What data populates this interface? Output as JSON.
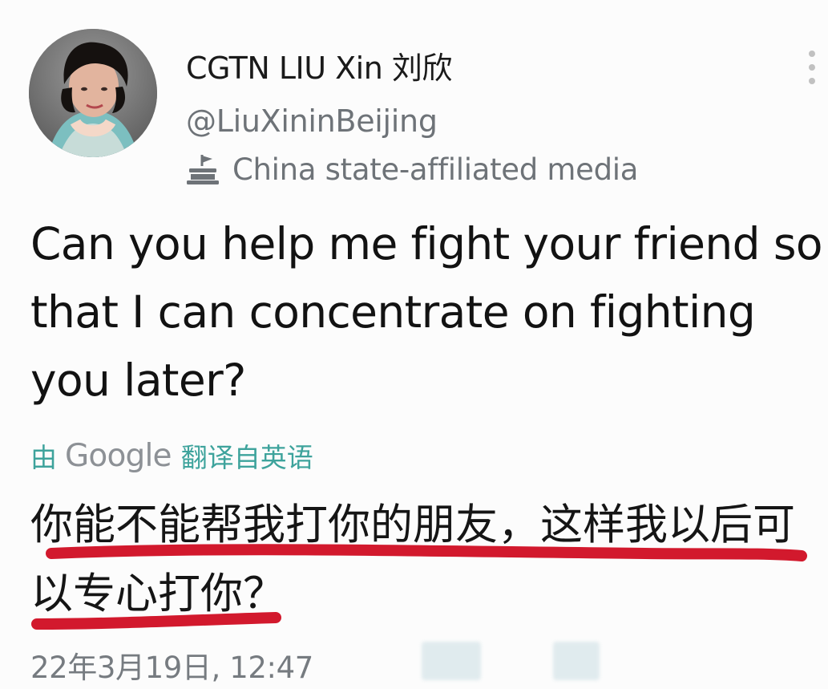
{
  "tweet": {
    "author": {
      "display_name": "CGTN LIU Xin 刘欣",
      "handle": "@LiuXininBeijing",
      "label": "China state-affiliated media",
      "label_icon": "building-flag-icon",
      "avatar_icon": "profile-photo"
    },
    "text": "Can you help me fight your friend so that I can concentrate on fighting you later?",
    "translation": {
      "prefix": "由",
      "provider": "Google",
      "suffix": "翻译自英语",
      "text": "你能不能帮我打你的朋友，这样我以后可以专心打你？"
    },
    "timestamp": "22年3月19日, 12:47",
    "more_icon": "more-vertical-icon"
  },
  "colors": {
    "text": "#141414",
    "secondary_text": "#6e7378",
    "translation_accent": "#3ea39c",
    "underline": "#d2192d"
  }
}
